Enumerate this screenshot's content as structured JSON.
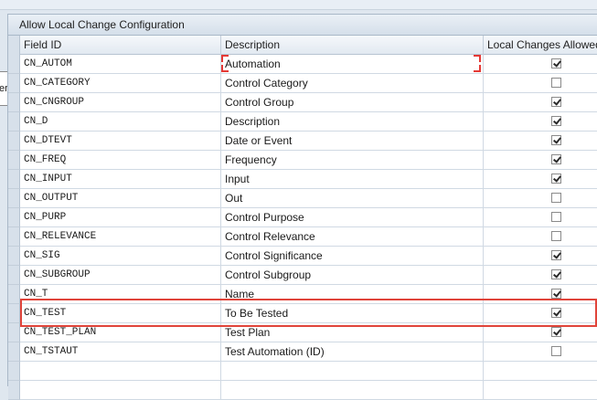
{
  "panel": {
    "title": "Allow Local Change Configuration"
  },
  "tooltip": {
    "text": "er"
  },
  "columns": [
    {
      "key": "field_id",
      "label": "Field ID"
    },
    {
      "key": "description",
      "label": "Description"
    },
    {
      "key": "local_changes",
      "label": "Local Changes Allowed"
    }
  ],
  "rows": [
    {
      "field_id": "CN_AUTOM",
      "description": "Automation",
      "allowed": true
    },
    {
      "field_id": "CN_CATEGORY",
      "description": "Control Category",
      "allowed": false
    },
    {
      "field_id": "CN_CNGROUP",
      "description": "Control Group",
      "allowed": true
    },
    {
      "field_id": "CN_D",
      "description": "Description",
      "allowed": true
    },
    {
      "field_id": "CN_DTEVT",
      "description": "Date or Event",
      "allowed": true
    },
    {
      "field_id": "CN_FREQ",
      "description": "Frequency",
      "allowed": true
    },
    {
      "field_id": "CN_INPUT",
      "description": "Input",
      "allowed": true
    },
    {
      "field_id": "CN_OUTPUT",
      "description": "Out",
      "allowed": false
    },
    {
      "field_id": "CN_PURP",
      "description": "Control Purpose",
      "allowed": false
    },
    {
      "field_id": "CN_RELEVANCE",
      "description": "Control Relevance",
      "allowed": false
    },
    {
      "field_id": "CN_SIG",
      "description": "Control Significance",
      "allowed": true
    },
    {
      "field_id": "CN_SUBGROUP",
      "description": "Control Subgroup",
      "allowed": true
    },
    {
      "field_id": "CN_T",
      "description": "Name",
      "allowed": true
    },
    {
      "field_id": "CN_TEST",
      "description": "To Be Tested",
      "allowed": true
    },
    {
      "field_id": "CN_TEST_PLAN",
      "description": "Test Plan",
      "allowed": true
    },
    {
      "field_id": "CN_TSTAUT",
      "description": "Test Automation (ID)",
      "allowed": false
    }
  ],
  "colors": {
    "highlight": "#e0443a",
    "focus": "#e53935"
  }
}
